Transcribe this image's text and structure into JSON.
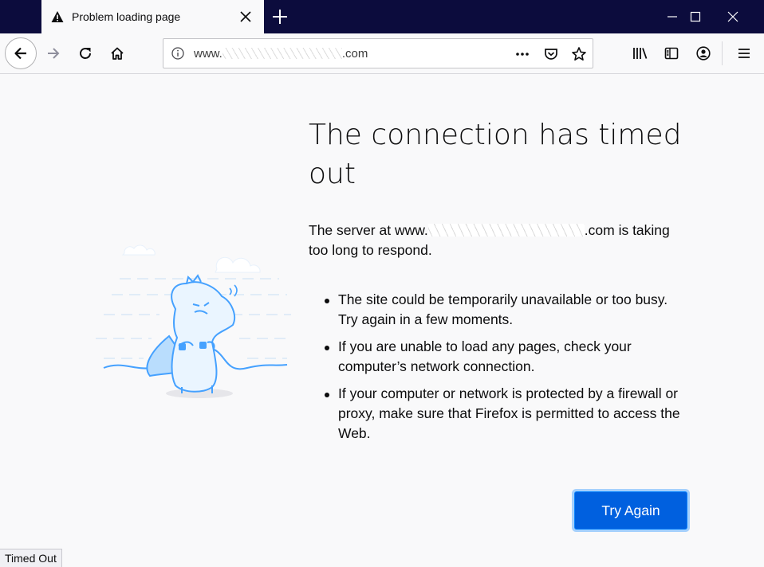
{
  "tab": {
    "title": "Problem loading page"
  },
  "urlbar": {
    "url_prefix": "www.",
    "url_suffix": ".com"
  },
  "page": {
    "title": "The connection has timed out",
    "desc_prefix": "The server at www.",
    "desc_suffix": ".com is taking too long to respond.",
    "bullets": [
      "The site could be temporarily unavailable or too busy. Try again in a few moments.",
      "If you are unable to load any pages, check your computer’s network connection.",
      "If your computer or network is protected by a firewall or proxy, make sure that Firefox is permitted to access the Web."
    ],
    "try_again_label": "Try Again"
  },
  "status": {
    "text": "Timed Out"
  },
  "colors": {
    "titlebar": "#0c0c3d",
    "accent": "#0060df",
    "illustration": "#45a1ff"
  },
  "icons": [
    "warning-icon",
    "close-icon",
    "plus-icon",
    "minimize-icon",
    "maximize-icon",
    "back-icon",
    "forward-icon",
    "reload-icon",
    "home-icon",
    "info-icon",
    "more-icon",
    "pocket-icon",
    "star-icon",
    "library-icon",
    "sidebar-icon",
    "account-icon",
    "menu-icon"
  ]
}
